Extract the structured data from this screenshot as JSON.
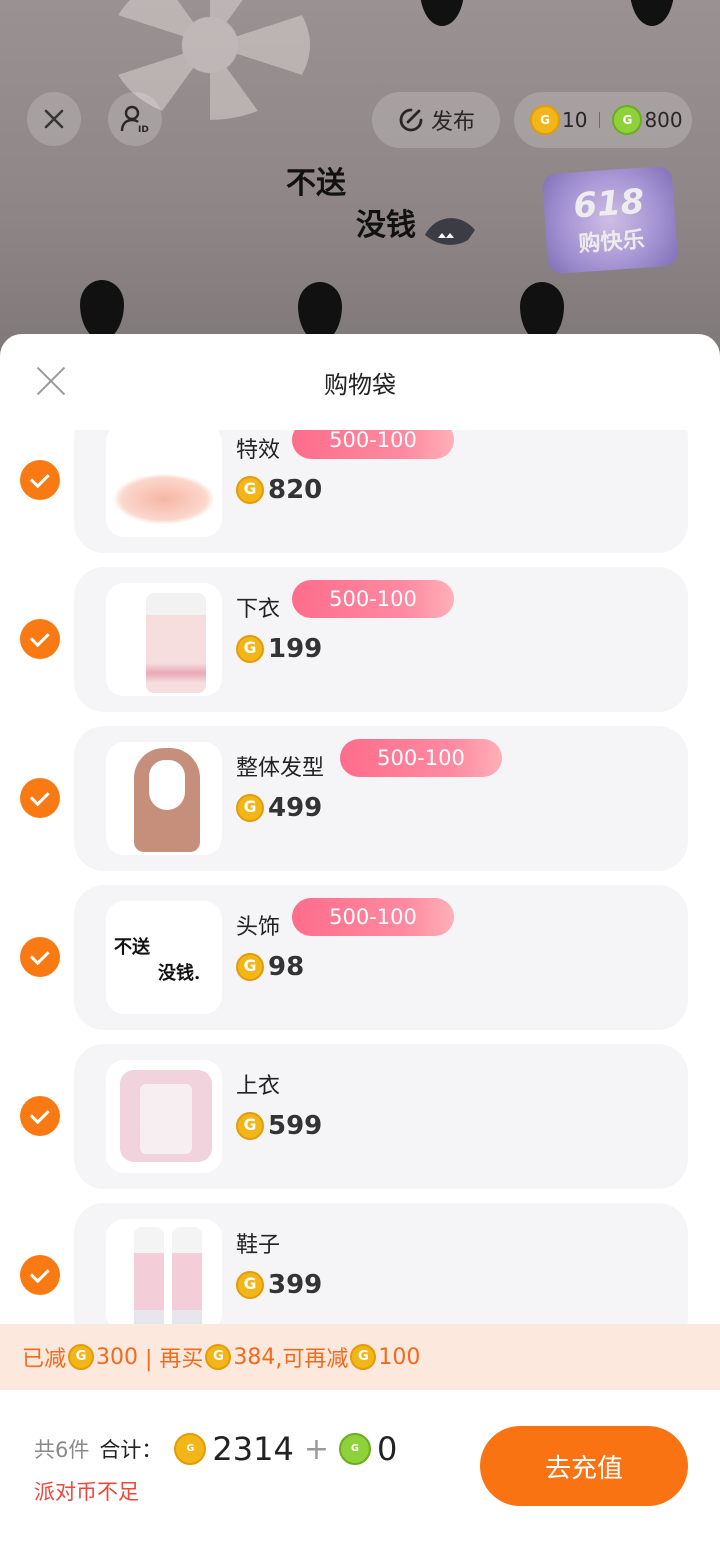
{
  "top_bar": {
    "publish_label": "发布",
    "gold_coin_balance": "10",
    "green_coin_balance": "800"
  },
  "background": {
    "handwritten_line1": "不送",
    "handwritten_line2": "没钱",
    "badge_number": "618",
    "badge_text": "购快乐"
  },
  "sheet": {
    "title": "购物袋"
  },
  "items": [
    {
      "name": "特效",
      "tag": "500-100",
      "price": "820"
    },
    {
      "name": "下衣",
      "tag": "500-100",
      "price": "199"
    },
    {
      "name": "整体发型",
      "tag": "500-100",
      "price": "499"
    },
    {
      "name": "头饰",
      "tag": "500-100",
      "price": "98",
      "thumb_text1": "不送",
      "thumb_text2": "没钱."
    },
    {
      "name": "上衣",
      "tag": "",
      "price": "599"
    },
    {
      "name": "鞋子",
      "tag": "",
      "price": "399"
    }
  ],
  "discount_bar": {
    "part1": "已减",
    "reduced": "300",
    "part2": " | 再买",
    "buy_more": "384",
    "part3": ",可再减",
    "more_reduce": "100"
  },
  "footer": {
    "count": "共6件",
    "total_label": "合计：",
    "gold_total": "2314",
    "plus": "+",
    "green_total": "0",
    "warning": "派对币不足",
    "recharge_label": "去充值"
  },
  "colors": {
    "accent_orange": "#f97313",
    "tag_pink": "#fe6d8b",
    "warning_red": "#f0453a"
  }
}
